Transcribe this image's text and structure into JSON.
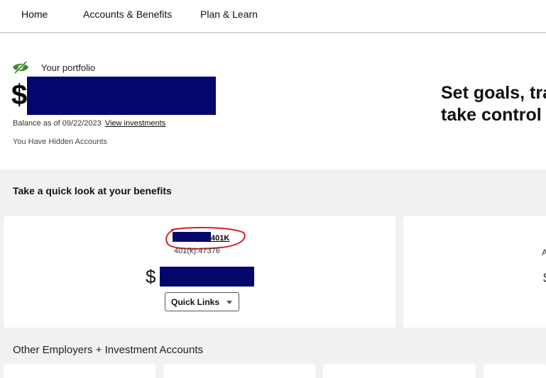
{
  "nav": {
    "items": [
      "Home",
      "Accounts & Benefits",
      "Plan & Learn"
    ]
  },
  "portfolio": {
    "icon": "eye-slash-icon",
    "label": "Your portfolio",
    "currency_symbol": "$",
    "balance_prefix": "Balance as of 09/22/2023",
    "view_link": "View investments",
    "hidden_note": "You Have Hidden Accounts"
  },
  "promo": {
    "line1": "Set goals, tra",
    "line2": "take control"
  },
  "benefits": {
    "title": "Take a quick look at your benefits",
    "card": {
      "account_name_suffix": "401K",
      "account_number": "401(k):47376",
      "currency_symbol": "$",
      "quick_links_label": "Quick Links"
    },
    "side_card": {
      "fragment1": "A",
      "fragment2": "$"
    }
  },
  "other": {
    "title": "Other Employers + Investment Accounts"
  },
  "colors": {
    "redaction": "#03066b",
    "annotation": "#d61f2c",
    "eye_icon": "#3a8a2a",
    "section_bg": "#f1f1f1"
  }
}
